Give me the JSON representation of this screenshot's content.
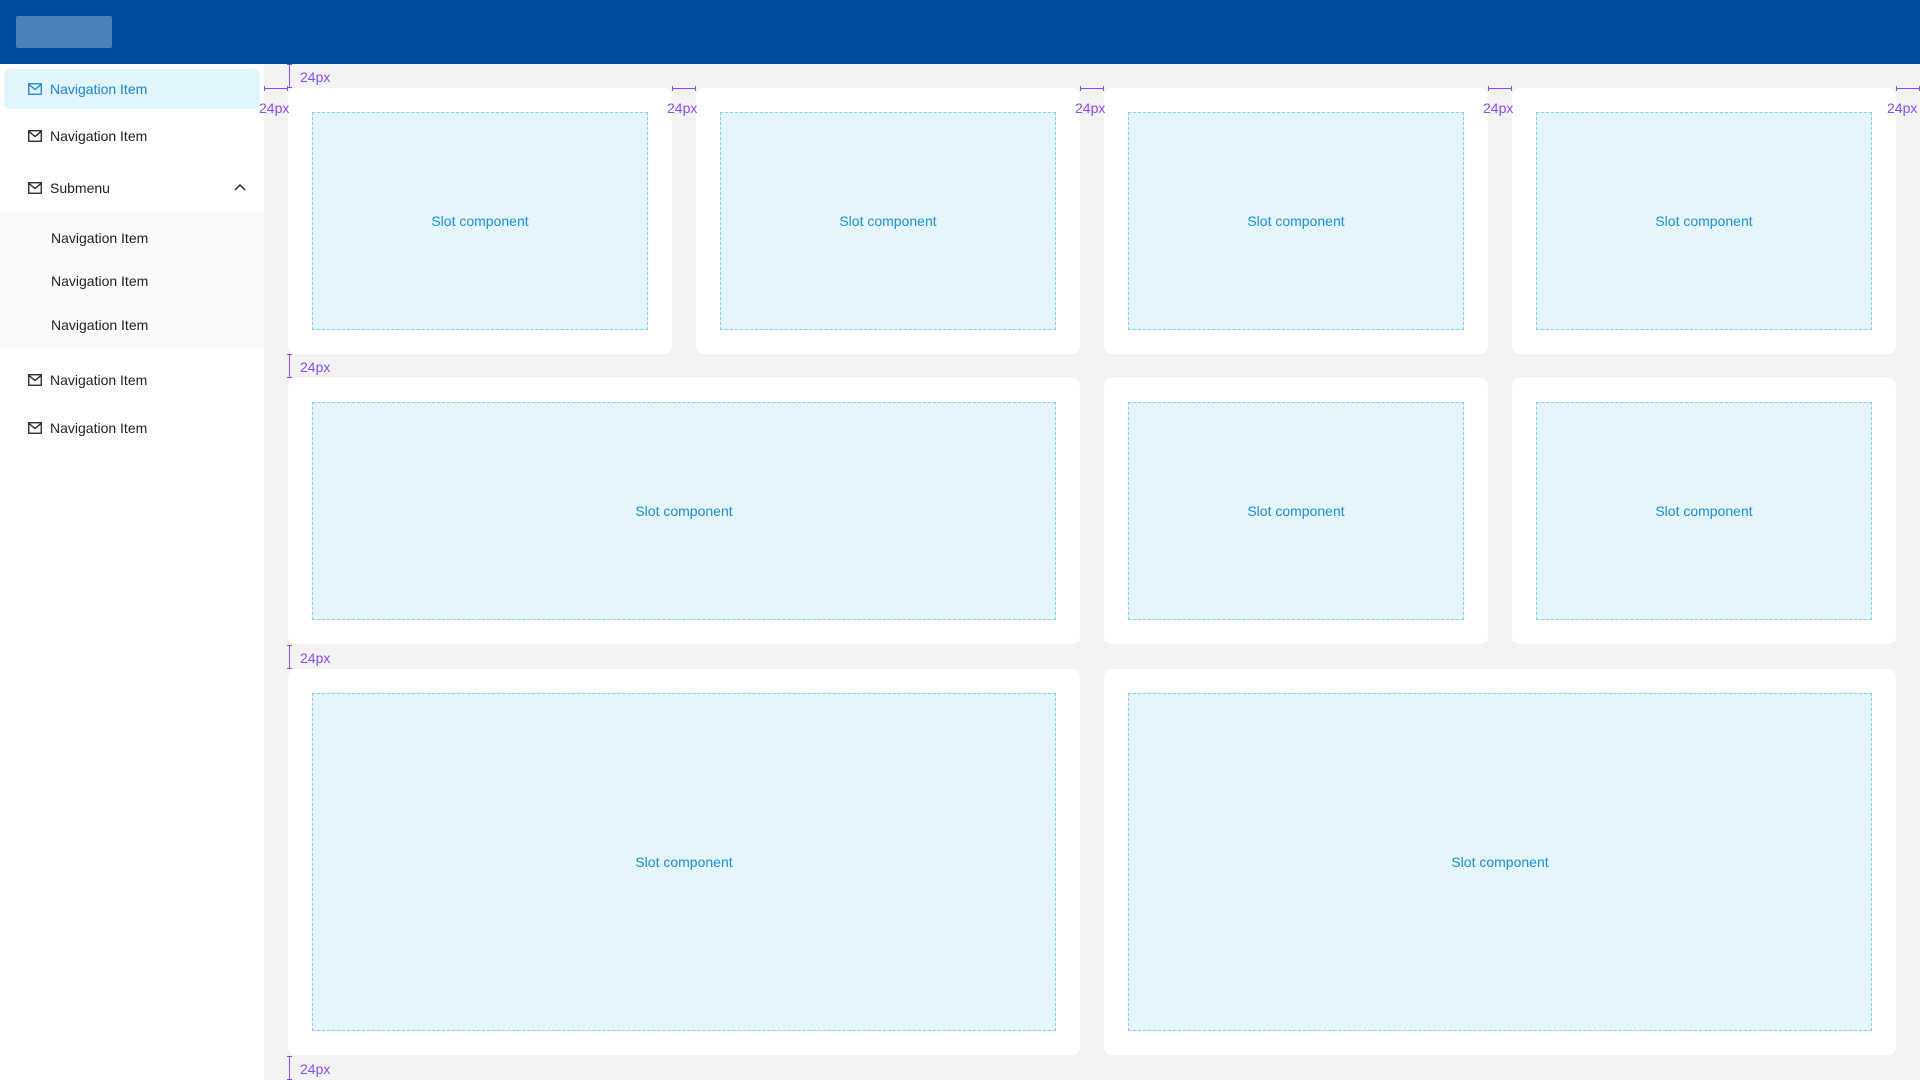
{
  "header": {
    "logo": "logo-placeholder"
  },
  "sidebar": {
    "items": [
      {
        "label": "Navigation Item",
        "icon": "mail-icon",
        "active": true
      },
      {
        "label": "Navigation Item",
        "icon": "mail-icon",
        "active": false
      }
    ],
    "submenu": {
      "label": "Submenu",
      "icon": "mail-icon",
      "expanded": true,
      "children": [
        "Navigation Item",
        "Navigation Item",
        "Navigation Item"
      ]
    },
    "items_after": [
      {
        "label": "Navigation Item",
        "icon": "mail-icon"
      },
      {
        "label": "Navigation Item",
        "icon": "mail-icon"
      }
    ]
  },
  "content": {
    "slot_label": "Slot component",
    "rows": [
      {
        "slots": [
          "Slot component",
          "Slot component",
          "Slot component",
          "Slot component"
        ]
      },
      {
        "slots": [
          "Slot component",
          "Slot component",
          "Slot component"
        ]
      },
      {
        "slots": [
          "Slot component",
          "Slot component"
        ]
      }
    ]
  },
  "spacing": {
    "gap_label": "24px"
  },
  "colors": {
    "header": "#004c9c",
    "accent": "#1586cf",
    "slot_fill": "#e4f5fc",
    "annotation": "#8a4cf5"
  }
}
